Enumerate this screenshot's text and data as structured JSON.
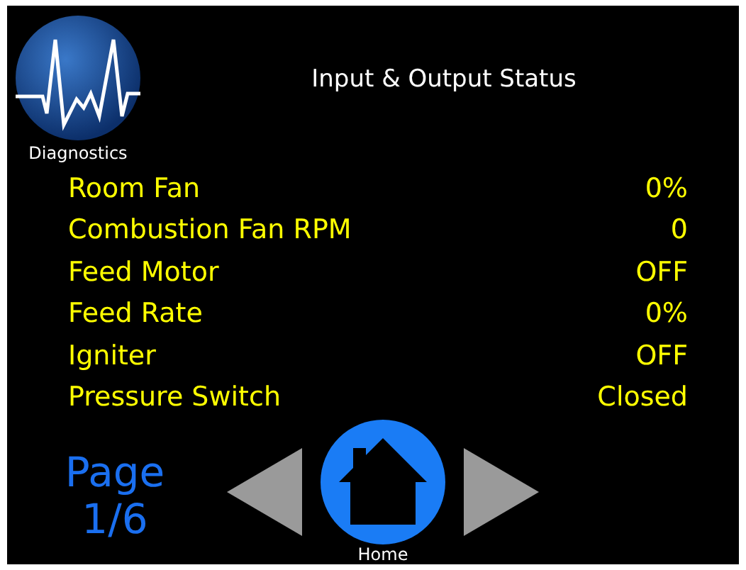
{
  "header": {
    "icon_label": "Diagnostics",
    "title": "Input & Output Status"
  },
  "rows": [
    {
      "label": "Room Fan",
      "value": "0%"
    },
    {
      "label": "Combustion Fan RPM",
      "value": "0"
    },
    {
      "label": "Feed Motor",
      "value": "OFF"
    },
    {
      "label": "Feed Rate",
      "value": "0%"
    },
    {
      "label": "Igniter",
      "value": "OFF"
    },
    {
      "label": "Pressure Switch",
      "value": "Closed"
    }
  ],
  "footer": {
    "page_word": "Page",
    "page_number": "1/6",
    "home_label": "Home"
  }
}
